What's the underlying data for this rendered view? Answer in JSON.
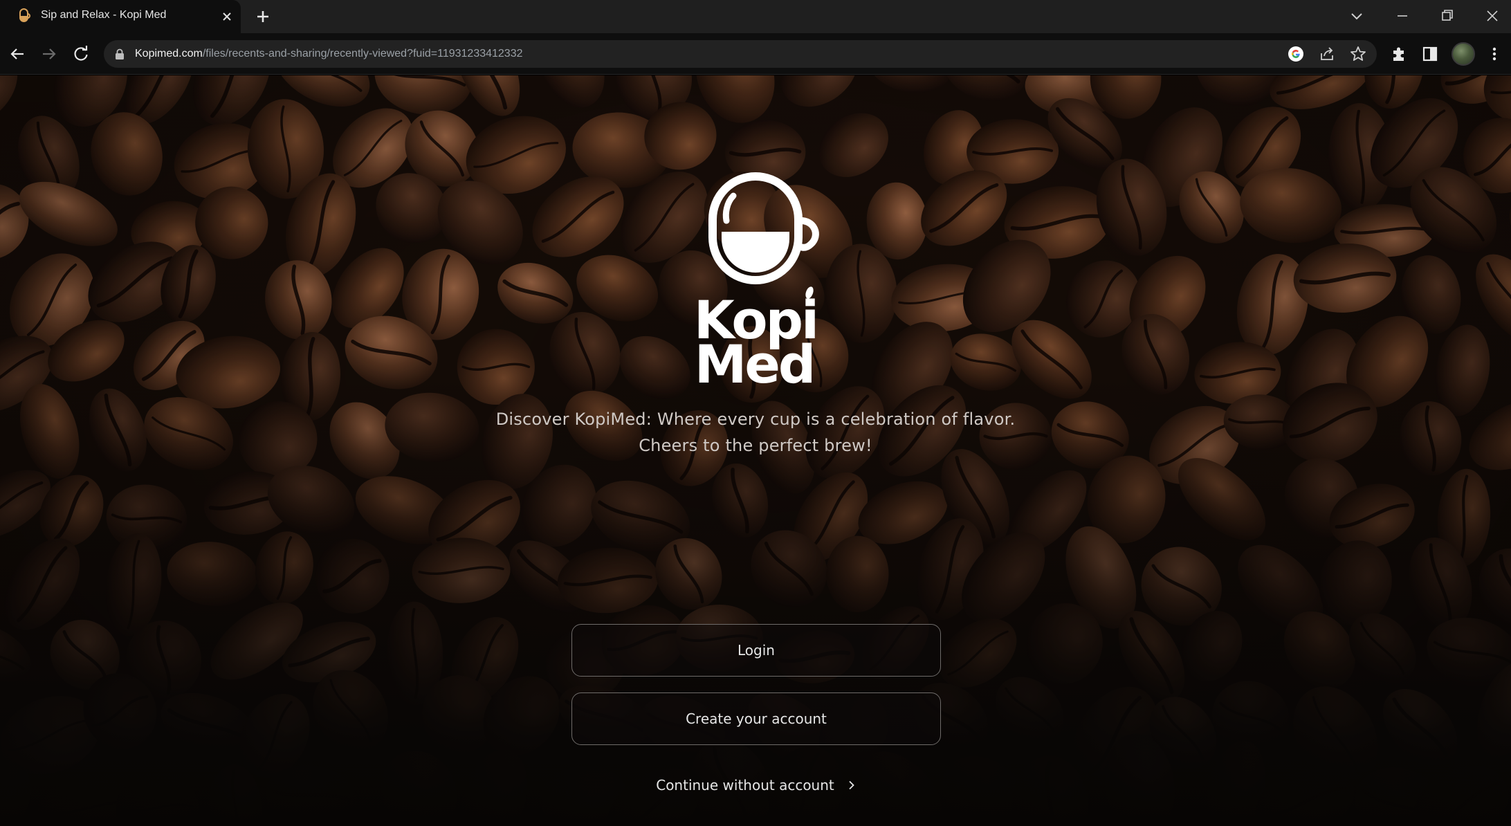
{
  "browser": {
    "tab_title": "Sip and Relax - Kopi Med",
    "url_host": "Kopimed.com",
    "url_path": "/files/recents-and-sharing/recently-viewed?fuid=11931233412332",
    "icons": [
      "back-icon",
      "forward-icon",
      "reload-icon",
      "lock-icon",
      "google-icon",
      "share-icon",
      "bookmark-star-icon",
      "extensions-icon",
      "side-panel-icon",
      "profile-avatar",
      "menu-icon"
    ]
  },
  "brand": {
    "logo_text": "KopiMed"
  },
  "hero": {
    "tagline_line1": "Discover KopiMed: Where every cup is a celebration of flavor.",
    "tagline_line2": "Cheers to the perfect brew!"
  },
  "actions": {
    "login_label": "Login",
    "create_label": "Create your account",
    "continue_label": "Continue without account"
  },
  "colors": {
    "background": "#120b07",
    "button_border": "#6e6b69",
    "text": "#e6e6e6"
  }
}
